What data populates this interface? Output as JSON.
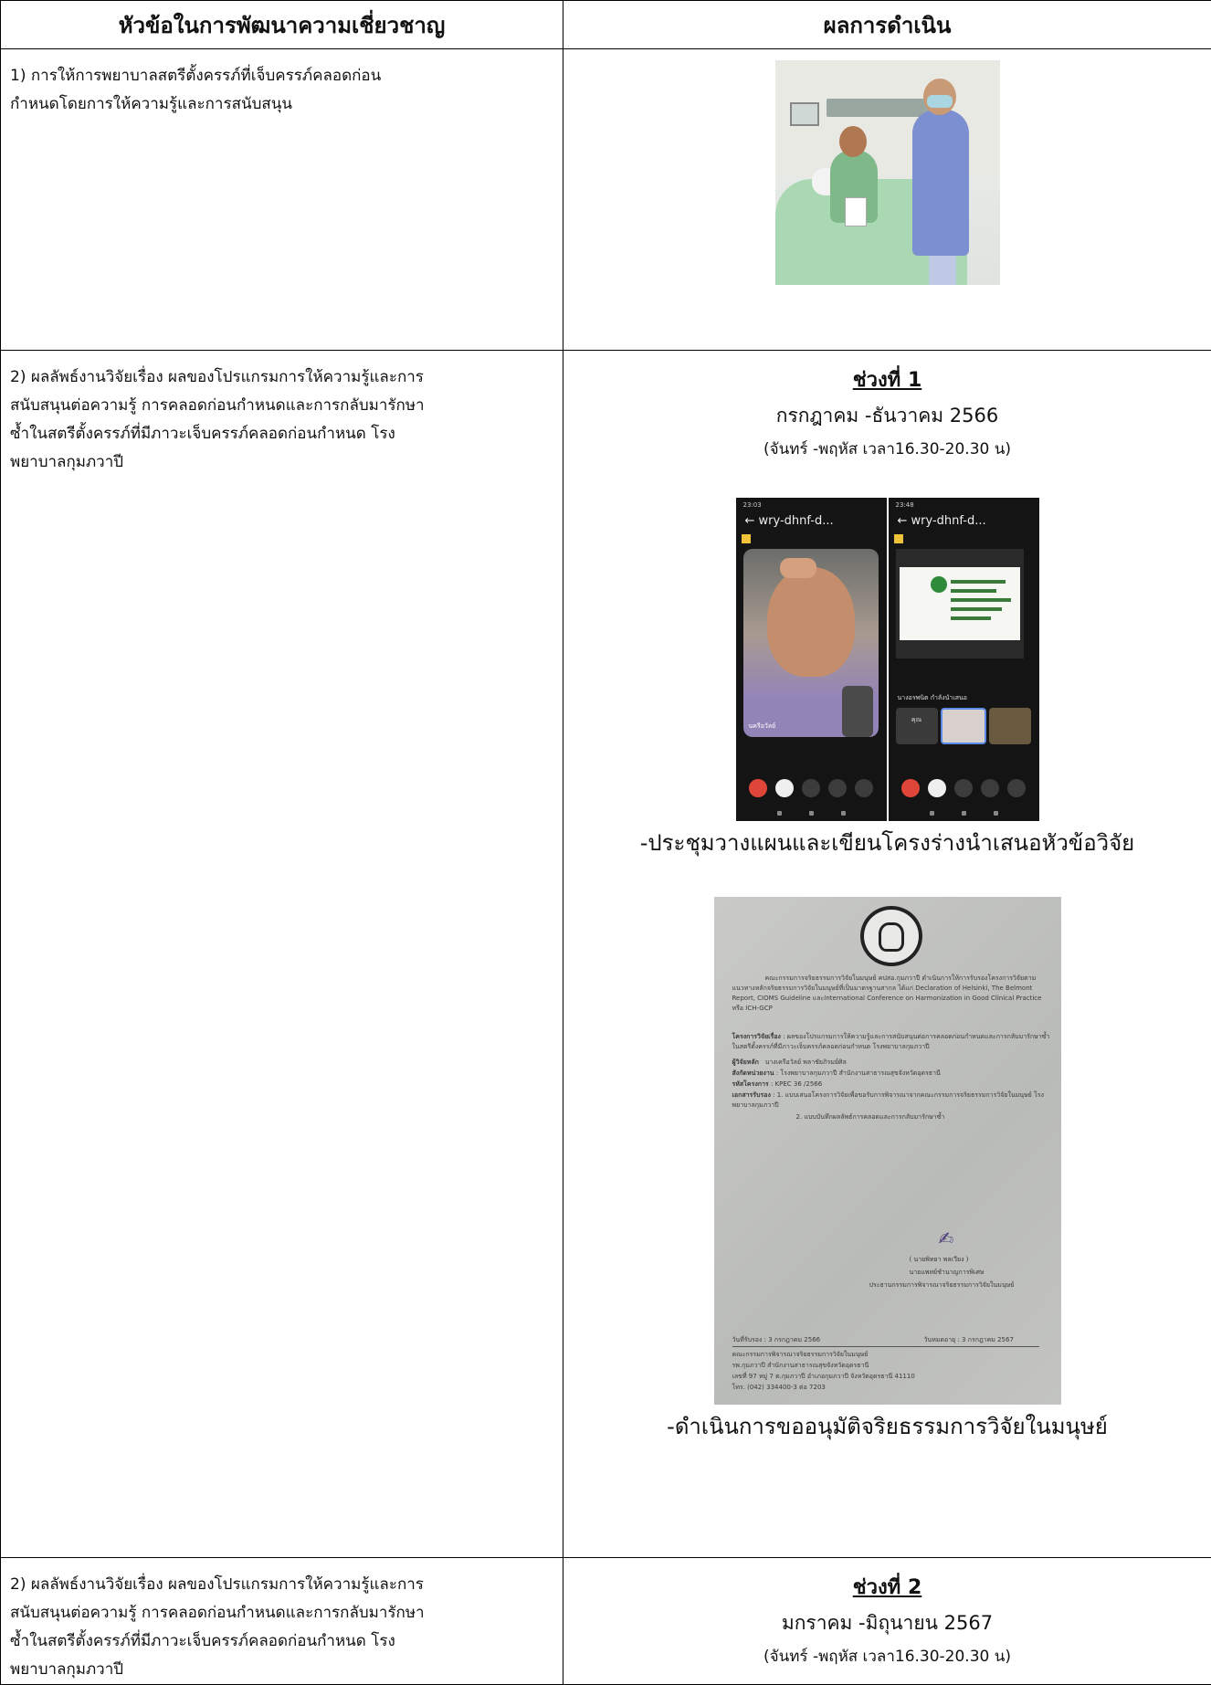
{
  "table": {
    "header_left": "หัวข้อในการพัฒนาความเชี่ยวชาญ",
    "header_right": "ผลการดำเนิน",
    "rows": [
      {
        "topic": "1) การให้การพยาบาลสตรีตั้งครรภ์ที่เจ็บครรภ์คลอดก่อนกำหนดโดยการให้ความรู้และการสนับสนุน"
      },
      {
        "topic": "2) ผลลัพธ์งานวิจัยเรื่อง ผลของโปรแกรมการให้ความรู้และการสนับสนุนต่อความรู้ การคลอดก่อนกำหนดและการกลับมารักษาซ้ำในสตรีตั้งครรภ์ที่มีภาวะเจ็บครรภ์คลอดก่อนกำหนด โรงพยาบาลกุมภวาปี",
        "period_heading": "ช่วงที่ 1",
        "period_dates": "กรกฎาคม -ธันวาคม 2566",
        "period_time": "(จันทร์ -พฤหัส เวลา16.30-20.30 น)",
        "caption_1": "-ประชุมวางแผนและเขียนโครงร่างนำเสนอหัวข้อวิจัย",
        "caption_2": "-ดำเนินการขออนุมัติจริยธรรมการวิจัยในมนุษย์"
      },
      {
        "topic": "2) ผลลัพธ์งานวิจัยเรื่อง ผลของโปรแกรมการให้ความรู้และการสนับสนุนต่อความรู้ การคลอดก่อนกำหนดและการกลับมารักษาซ้ำในสตรีตั้งครรภ์ที่มีภาวะเจ็บครรภ์คลอดก่อนกำหนด โรงพยาบาลกุมภวาปี",
        "period_heading": "ช่วงที่ 2",
        "period_dates": "มกราคม -มิถุนายน 2567",
        "period_time": "(จันทร์ -พฤหัส เวลา16.30-20.30 น)"
      }
    ]
  },
  "phone_screenshots": {
    "left": {
      "time": "23:03",
      "title": "wry-dhnf-d...",
      "participant": "นครีอวัลย์"
    },
    "right": {
      "time": "23:48",
      "title": "wry-dhnf-d...",
      "presenting": "นางอรพนิต กำลังนำเสนอ",
      "tile_name": "คุณ"
    }
  },
  "certificate": {
    "intro": "คณะกรรมการจริยธรรมการวิจัยในมนุษย์ คปสอ.กุมภวาปี ดำเนินการให้การรับรองโครงการวิจัยตามแนวทางหลักจริยธรรมการวิจัยในมนุษย์ที่เป็นมาตรฐานสากล ได้แก่ Declaration of Helsinki, The Belmont Report, CIOMS Guideline และInternational Conference on Harmonization in Good Clinical Practice หรือ ICH-GCP",
    "project_label": "โครงการวิจัยเรื่อง",
    "project": ": ผลของโปรแกรมการให้ความรู้และการสนับสนุนต่อการคลอดก่อนกำหนดและการกลับมารักษาซ้ำในสตรีตั้งครรภ์ที่มีภาวะเจ็บครรภ์คลอดก่อนกำหนด โรงพยาบาลกุมภวาปี",
    "researcher_label": "ผู้วิจัยหลัก",
    "researcher": "นางเครือวัลย์ พลาชัยภิรมย์ศิล",
    "affiliation_label": "สังกัดหน่วยงาน",
    "affiliation": ": โรงพยาบาลกุมภวาปี สำนักงานสาธารณสุขจังหวัดอุดรธานี",
    "code_label": "รหัสโครงการ",
    "code": ": KPEC 36 /2566",
    "docs_label": "เอกสารรับรอง",
    "docs_1": ": 1. แบบเสนอโครงการวิจัยเพื่อขอรับการพิจารณาจากคณะกรรมการจริยธรรมการวิจัยในมนุษย์ โรงพยาบาลกุมภวาปี",
    "docs_2": "2. แบบบันทึกผลลัพธ์การคลอดและการกลับมารักษาซ้ำ",
    "signer": "( นายพิทยา พลเวียง )",
    "signer_title": "นายแพทย์ชำนาญการพิเศษ",
    "signer_role": "ประธานกรรมการพิจารณาจริยธรรมการวิจัยในมนุษย์",
    "approved": "วันที่รับรอง : 3 กรกฎาคม 2566",
    "expires": "วันหมดอายุ : 3 กรกฎาคม 2567",
    "footer_1": "คณะกรรมการพิจารณาจริยธรรมการวิจัยในมนุษย์",
    "footer_2": "รพ.กุมภวาปี สำนักงานสาธารณสุขจังหวัดอุดรธานี",
    "footer_3": "เลขที่ 97 หมู่ 7 ต.กุมภวาปี อำเภอกุมภวาปี จังหวัดอุดรธานี 41110",
    "footer_4": "โทร. (042) 334400-3 ต่อ 7203"
  }
}
